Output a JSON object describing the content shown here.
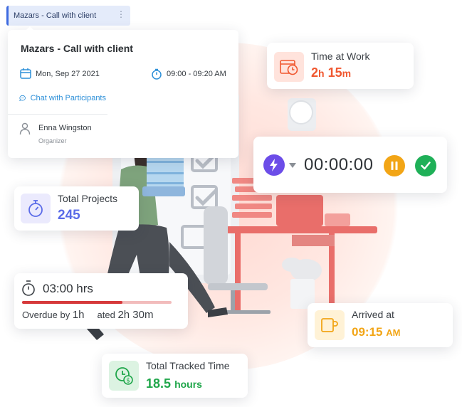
{
  "event_chip": {
    "label": "Mazars - Call with client"
  },
  "event_popup": {
    "title": "Mazars - Call with client",
    "date": "Mon, Sep 27 2021",
    "time": "09:00 - 09:20 AM",
    "chat_link": "Chat with Participants",
    "person_name": "Enna Wingston",
    "person_role": "Organizer"
  },
  "time_at_work": {
    "label": "Time at Work",
    "hours": "2",
    "h_unit": "h",
    "minutes": "15",
    "m_unit": "m"
  },
  "timer": {
    "display": "00:00:00"
  },
  "total_projects": {
    "label": "Total Projects",
    "value": "245"
  },
  "overdue": {
    "hours": "03:00 hrs",
    "overdue_prefix": "Overdue by",
    "overdue_value": "1h",
    "estimated_suffix": "ated",
    "estimated_value": "2h 30m",
    "progress": 0.67
  },
  "arrived": {
    "label": "Arrived at",
    "time": "09:15",
    "ampm": "AM"
  },
  "tracked": {
    "label": "Total Tracked Time",
    "value": "18.5",
    "unit": "hours"
  },
  "colors": {
    "orange": "#f0572f",
    "blue": "#5a6be8",
    "gold": "#f2a516",
    "green": "#1fa64a",
    "red_bar": "#d6393b",
    "purple": "#6c4de8"
  }
}
